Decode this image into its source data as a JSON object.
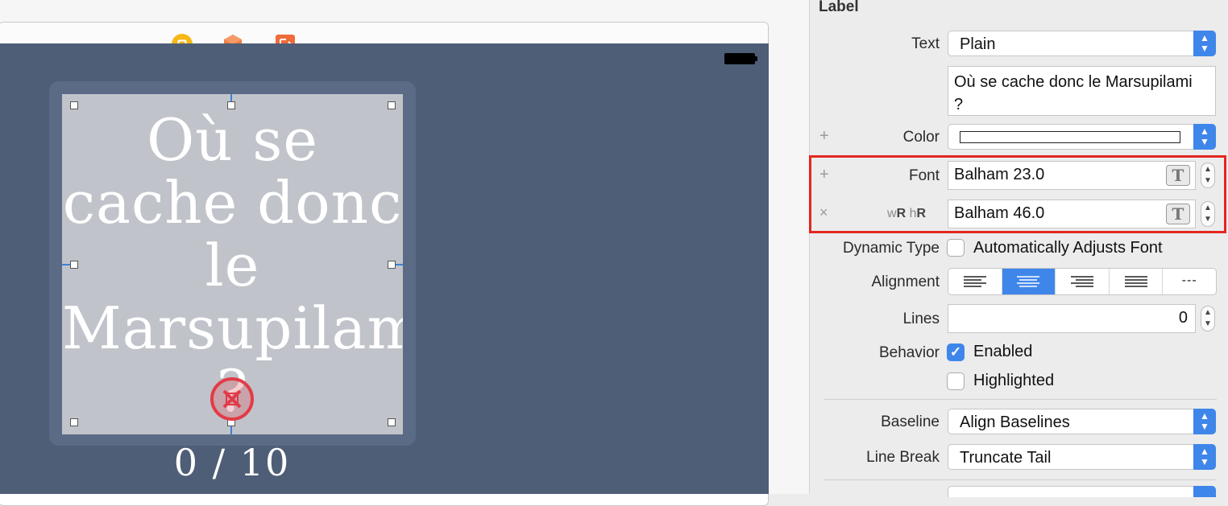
{
  "inspector": {
    "section_title": "Label",
    "text": {
      "label": "Text",
      "value": "Plain",
      "content": "Où se cache donc le Marsupilami ?"
    },
    "color": {
      "label": "Color",
      "add_mark": "+"
    },
    "font": {
      "label": "Font",
      "value": "Balham 23.0",
      "add_mark": "+"
    },
    "font_variation": {
      "label_w": "w",
      "label_wR": "R",
      "label_h": "h",
      "label_hR": "R",
      "value": "Balham 46.0",
      "remove_mark": "×"
    },
    "dynamic_type": {
      "label": "Dynamic Type",
      "checkbox_label": "Automatically Adjusts Font",
      "checked": false
    },
    "alignment": {
      "label": "Alignment",
      "options": [
        "left",
        "center",
        "right",
        "justified",
        "natural"
      ],
      "selected": "center",
      "natural_glyph": "---"
    },
    "lines": {
      "label": "Lines",
      "value": "0"
    },
    "behavior": {
      "label": "Behavior",
      "enabled_label": "Enabled",
      "enabled": true,
      "highlighted_label": "Highlighted",
      "highlighted": false
    },
    "baseline": {
      "label": "Baseline",
      "value": "Align Baselines"
    },
    "line_break": {
      "label": "Line Break",
      "value": "Truncate Tail"
    }
  },
  "canvas": {
    "label_text": "Où se cache donc le Marsupilami ?",
    "counter": "0 / 10",
    "dock_icons": [
      "view-controller-icon",
      "first-responder-icon",
      "exit-icon"
    ]
  },
  "colors": {
    "accent": "#3f86ea",
    "highlight": "#e3261f",
    "scene_bg": "#4e5e76",
    "label_bg": "#c0c4ca"
  }
}
